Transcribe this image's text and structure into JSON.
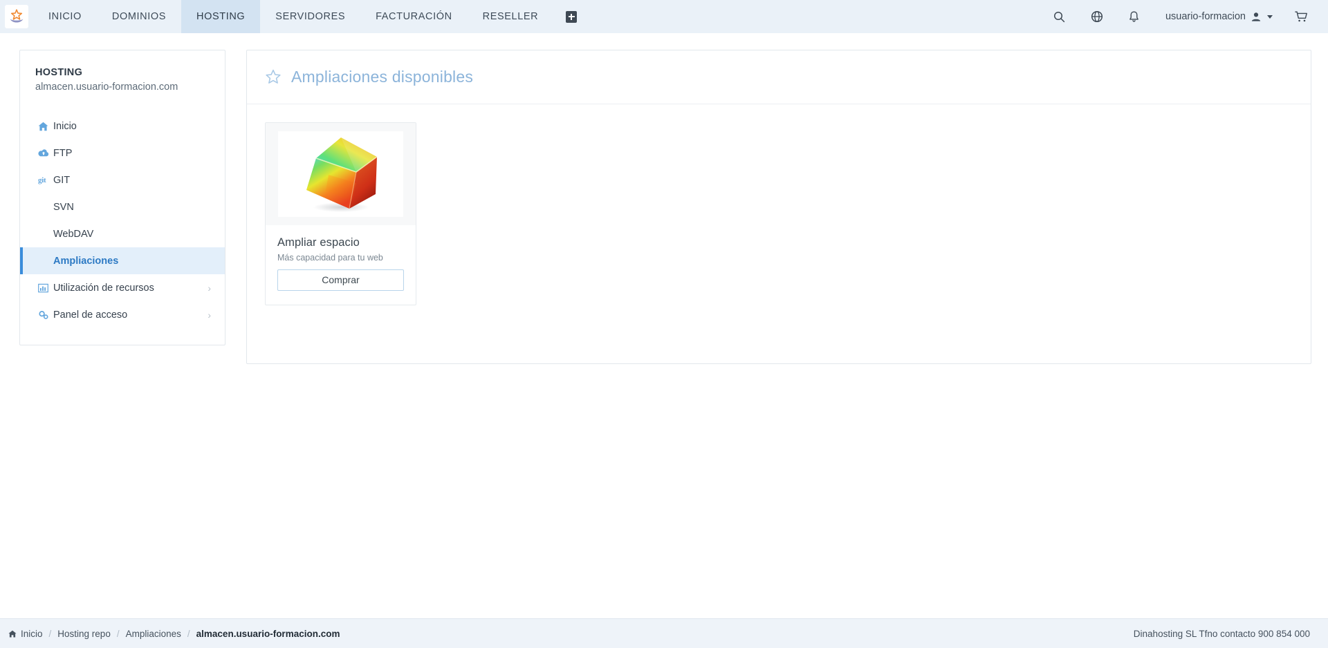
{
  "topnav": {
    "logo_name": "dinahosting-logo",
    "items": [
      {
        "label": "INICIO",
        "active": false
      },
      {
        "label": "DOMINIOS",
        "active": false
      },
      {
        "label": "HOSTING",
        "active": true
      },
      {
        "label": "SERVIDORES",
        "active": false
      },
      {
        "label": "FACTURACIÓN",
        "active": false
      },
      {
        "label": "RESELLER",
        "active": false
      }
    ],
    "add_button_label": "+",
    "icons": [
      "search-icon",
      "support-globe-icon",
      "notifications-bell-icon"
    ],
    "user": "usuario-formacion",
    "cart_icon": "shopping-cart-icon"
  },
  "sidebar": {
    "title": "HOSTING",
    "subtitle": "almacen.usuario-formacion.com",
    "items": [
      {
        "label": "Inicio",
        "icon": "home-icon",
        "active": false,
        "chevron": false
      },
      {
        "label": "FTP",
        "icon": "cloud-upload-icon",
        "active": false,
        "chevron": false
      },
      {
        "label": "GIT",
        "icon": "git-icon",
        "active": false,
        "chevron": false
      },
      {
        "label": "SVN",
        "icon": "",
        "active": false,
        "chevron": false
      },
      {
        "label": "WebDAV",
        "icon": "",
        "active": false,
        "chevron": false
      },
      {
        "label": "Ampliaciones",
        "icon": "",
        "active": true,
        "chevron": false
      },
      {
        "label": "Utilización de recursos",
        "icon": "chart-bar-icon",
        "active": false,
        "chevron": true
      },
      {
        "label": "Panel de acceso",
        "icon": "gears-icon",
        "active": false,
        "chevron": true
      }
    ]
  },
  "main": {
    "title": "Ampliaciones disponibles",
    "title_icon": "star-outline-icon",
    "cards": [
      {
        "image_name": "rainbow-cube-image",
        "title": "Ampliar espacio",
        "subtitle": "Más capacidad para tu web",
        "button_label": "Comprar"
      }
    ]
  },
  "footer": {
    "breadcrumb": [
      {
        "label": "Inicio",
        "icon": "home-icon",
        "current": false
      },
      {
        "label": "Hosting repo",
        "current": false
      },
      {
        "label": "Ampliaciones",
        "current": false
      },
      {
        "label": "almacen.usuario-formacion.com",
        "current": true
      }
    ],
    "separator": "/",
    "contact": "Dinahosting SL Tfno contacto 900 854 000"
  },
  "colors": {
    "nav_bg": "#eaf1f8",
    "nav_active_bg": "#d3e3f2",
    "accent_blue": "#3a8ddb",
    "sidebar_active_bg": "#e3effa",
    "title_blue": "#8cb4da",
    "footer_bg": "#eef3f9"
  }
}
